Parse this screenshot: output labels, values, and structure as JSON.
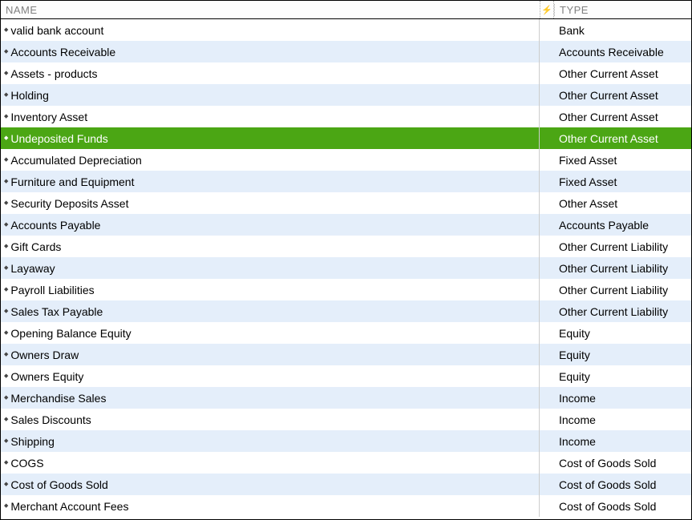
{
  "columns": {
    "name": "NAME",
    "type": "TYPE"
  },
  "lightning_icon": "⚡",
  "diamond_icon": "◆",
  "selected_color": "#4ba614",
  "alt_row_color": "#e4eefa",
  "rows": [
    {
      "name": "valid bank account",
      "type": "Bank",
      "alt": false,
      "selected": false
    },
    {
      "name": "Accounts Receivable",
      "type": "Accounts Receivable",
      "alt": true,
      "selected": false
    },
    {
      "name": "Assets - products",
      "type": "Other Current Asset",
      "alt": false,
      "selected": false
    },
    {
      "name": "Holding",
      "type": "Other Current Asset",
      "alt": true,
      "selected": false
    },
    {
      "name": "Inventory Asset",
      "type": "Other Current Asset",
      "alt": false,
      "selected": false
    },
    {
      "name": "Undeposited Funds",
      "type": "Other Current Asset",
      "alt": true,
      "selected": true
    },
    {
      "name": "Accumulated Depreciation",
      "type": "Fixed Asset",
      "alt": false,
      "selected": false
    },
    {
      "name": "Furniture and Equipment",
      "type": "Fixed Asset",
      "alt": true,
      "selected": false
    },
    {
      "name": "Security Deposits Asset",
      "type": "Other Asset",
      "alt": false,
      "selected": false
    },
    {
      "name": "Accounts Payable",
      "type": "Accounts Payable",
      "alt": true,
      "selected": false
    },
    {
      "name": "Gift Cards",
      "type": "Other Current Liability",
      "alt": false,
      "selected": false
    },
    {
      "name": "Layaway",
      "type": "Other Current Liability",
      "alt": true,
      "selected": false
    },
    {
      "name": "Payroll Liabilities",
      "type": "Other Current Liability",
      "alt": false,
      "selected": false
    },
    {
      "name": "Sales Tax Payable",
      "type": "Other Current Liability",
      "alt": true,
      "selected": false
    },
    {
      "name": "Opening Balance Equity",
      "type": "Equity",
      "alt": false,
      "selected": false
    },
    {
      "name": "Owners Draw",
      "type": "Equity",
      "alt": true,
      "selected": false
    },
    {
      "name": "Owners Equity",
      "type": "Equity",
      "alt": false,
      "selected": false
    },
    {
      "name": "Merchandise Sales",
      "type": "Income",
      "alt": true,
      "selected": false
    },
    {
      "name": "Sales Discounts",
      "type": "Income",
      "alt": false,
      "selected": false
    },
    {
      "name": "Shipping",
      "type": "Income",
      "alt": true,
      "selected": false
    },
    {
      "name": "COGS",
      "type": "Cost of Goods Sold",
      "alt": false,
      "selected": false
    },
    {
      "name": "Cost of Goods Sold",
      "type": "Cost of Goods Sold",
      "alt": true,
      "selected": false
    },
    {
      "name": "Merchant Account Fees",
      "type": "Cost of Goods Sold",
      "alt": false,
      "selected": false
    }
  ]
}
